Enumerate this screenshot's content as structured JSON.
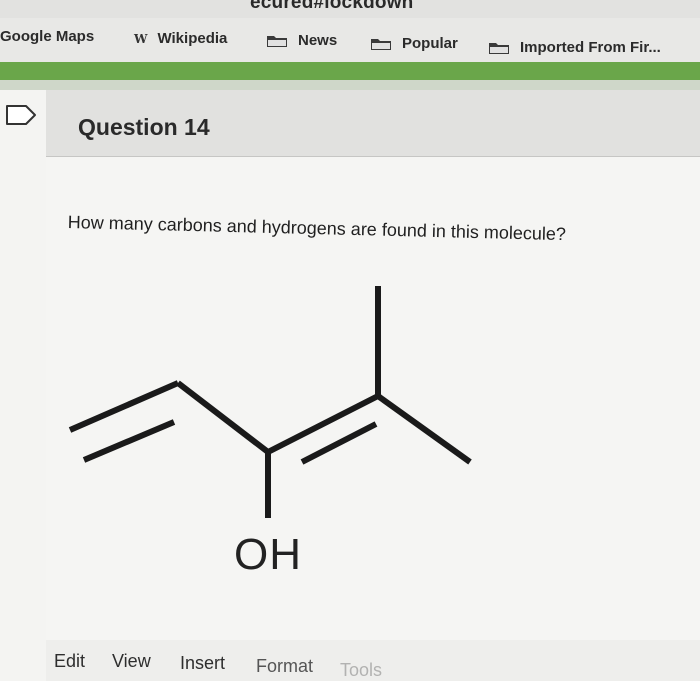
{
  "browser": {
    "url_fragment": "ecured#lockdown",
    "bookmarks": [
      {
        "label": "Google Maps",
        "icon": "none"
      },
      {
        "label": "Wikipedia",
        "icon": "wikipedia-w-icon"
      },
      {
        "label": "News",
        "icon": "folder-icon"
      },
      {
        "label": "Popular",
        "icon": "folder-icon"
      },
      {
        "label": "Imported From Fir...",
        "icon": "folder-icon"
      }
    ],
    "accent_color": "#6aa64a"
  },
  "question": {
    "title": "Question 14",
    "prompt": "How many carbons and hydrogens are found in this molecule?",
    "molecule_label": "OH"
  },
  "editor": {
    "menu": [
      "Edit",
      "View",
      "Insert",
      "Format",
      "Tools"
    ]
  }
}
